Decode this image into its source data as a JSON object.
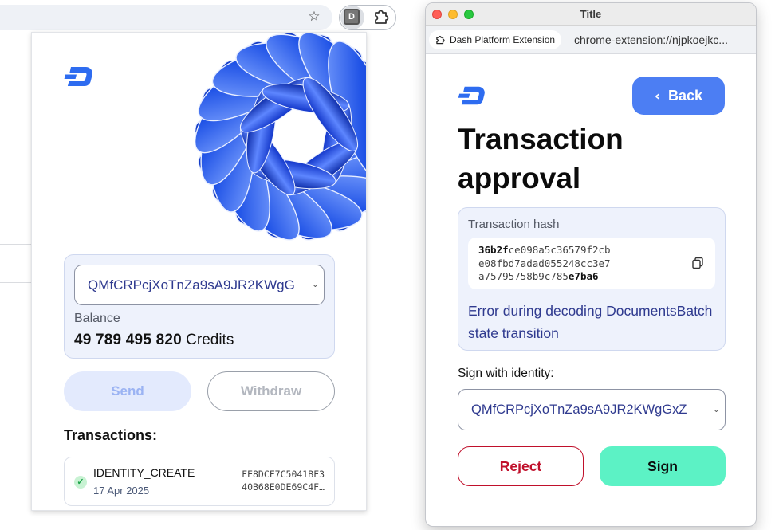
{
  "browser": {
    "star_icon": "star-icon",
    "extension_letter": "D",
    "puzzle_icon": "puzzle-icon"
  },
  "popup": {
    "identity_value": "QMfCRPcjXoTnZa9sA9JR2KWgG",
    "balance_label": "Balance",
    "balance_amount": "49 789 495 820",
    "balance_unit": "Credits",
    "send_label": "Send",
    "withdraw_label": "Withdraw",
    "transactions_heading": "Transactions:",
    "transactions": [
      {
        "type": "IDENTITY_CREATE",
        "date": "17 Apr 2025",
        "hash_line1": "FE8DCF7C5041BF3",
        "hash_line2": "40B68E0DE69C4F…",
        "status": "success"
      }
    ]
  },
  "window": {
    "title": "Title",
    "tab_label": "Dash Platform Extension",
    "url": "chrome-extension://njpkoejkc...",
    "back_label": "Back",
    "page_title": "Transaction approval",
    "hash_label": "Transaction hash",
    "hash": {
      "l1_bold": "36b2f",
      "l1_rest": "ce098a5c36579f2cb",
      "l2": "e08fbd7adad055248cc3e7",
      "l3_rest": "a75795758b9c785",
      "l3_bold": "e7ba6"
    },
    "error_message": "Error during decoding DocumentsBatch state transition",
    "sign_with_label": "Sign with identity:",
    "identity_value": "QMfCRPcjXoTnZa9sA9JR2KWgGxZ",
    "reject_label": "Reject",
    "sign_label": "Sign"
  },
  "colors": {
    "accent_blue": "#4c7ef3",
    "dash_blue": "#2e6cf0",
    "reject_red": "#c0102b",
    "sign_mint": "#5cf2c5"
  }
}
